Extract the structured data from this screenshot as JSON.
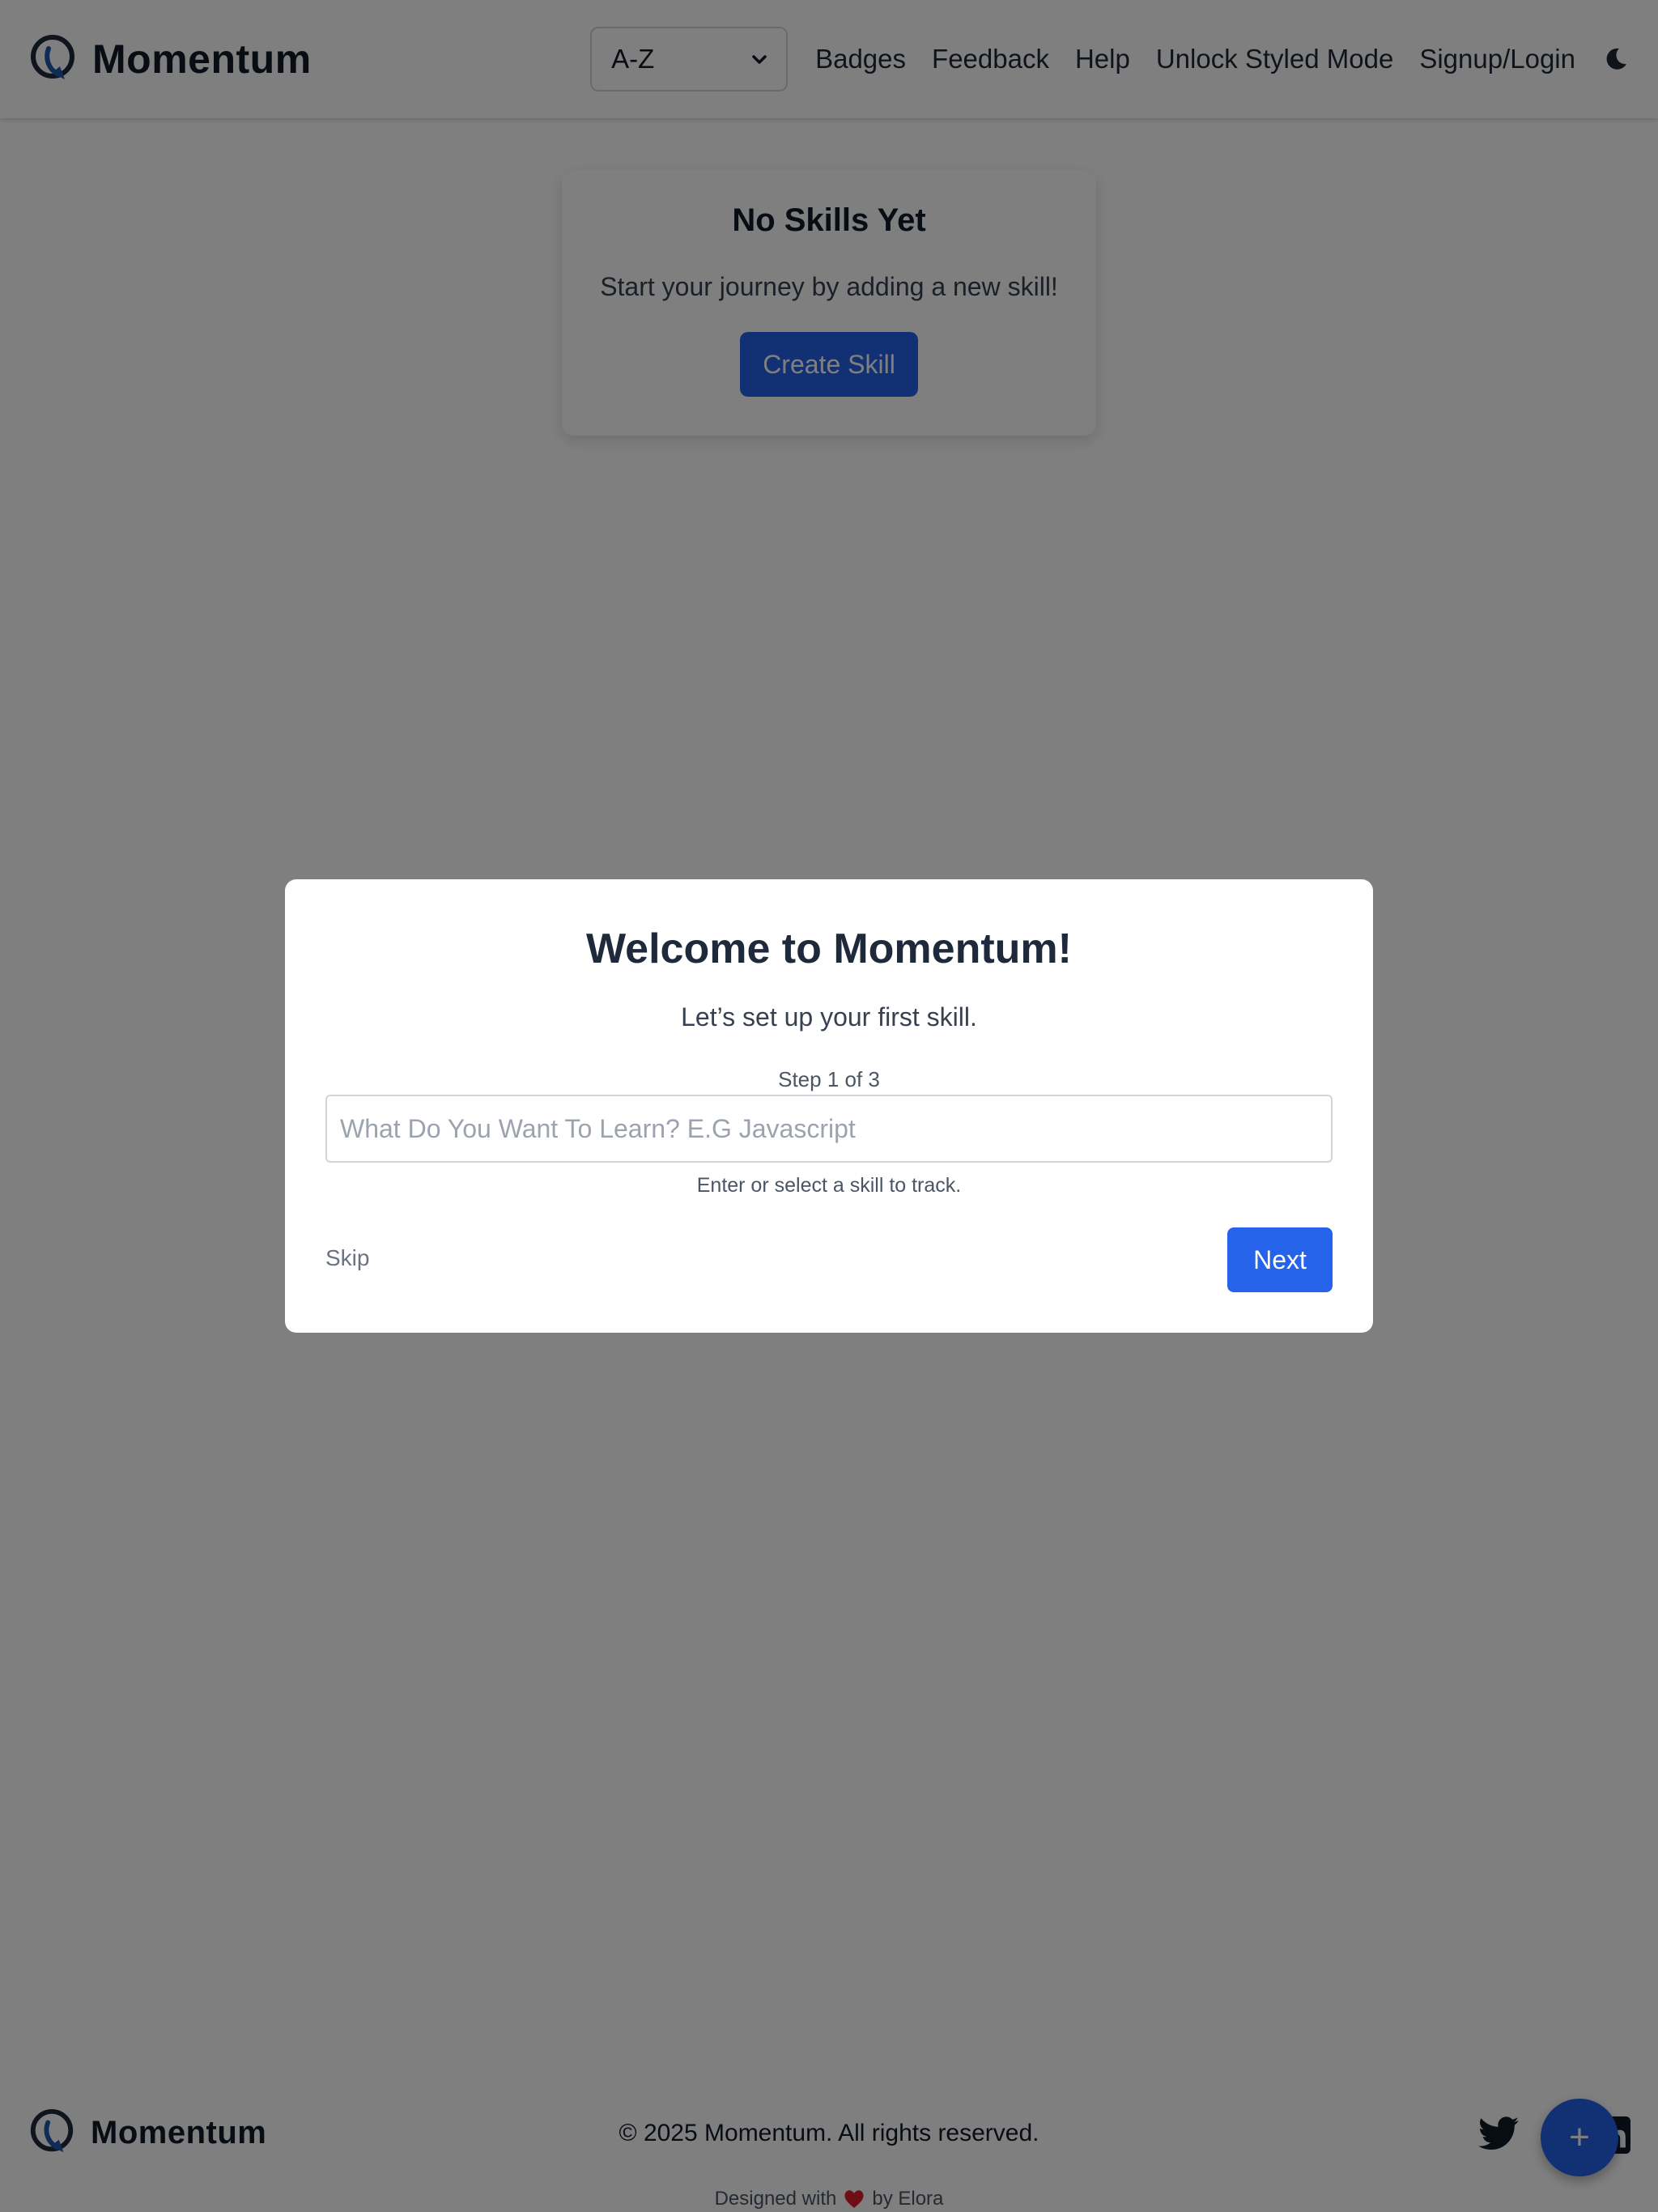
{
  "header": {
    "brand": "Momentum",
    "sort": {
      "selected": "A-Z"
    },
    "nav": {
      "badges": "Badges",
      "feedback": "Feedback",
      "help": "Help",
      "unlock": "Unlock Styled Mode",
      "signup": "Signup/Login"
    }
  },
  "empty_state": {
    "title": "No Skills Yet",
    "subtitle": "Start your journey by adding a new skill!",
    "button": "Create Skill"
  },
  "modal": {
    "title": "Welcome to Momentum!",
    "subtitle": "Let’s set up your first skill.",
    "step": "Step 1 of 3",
    "input_placeholder": "What Do You Want To Learn? E.G Javascript",
    "hint": "Enter or select a skill to track.",
    "skip": "Skip",
    "next": "Next"
  },
  "footer": {
    "brand": "Momentum",
    "copyright": "© 2025 Momentum. All rights reserved.",
    "designed_prefix": "Designed with",
    "designed_suffix": "by Elora",
    "fab": "+"
  },
  "icons": {
    "logo": "momentum-logo-icon",
    "theme": "moon-icon",
    "select": "chevron-down-icon",
    "heart": "heart-icon",
    "twitter": "twitter-icon",
    "linkedin": "linkedin-icon"
  },
  "colors": {
    "primary": "#2563eb",
    "overlay": "rgba(0,0,0,0.5)",
    "logo_blue": "#1e5aa8",
    "text_dark": "#111827"
  }
}
